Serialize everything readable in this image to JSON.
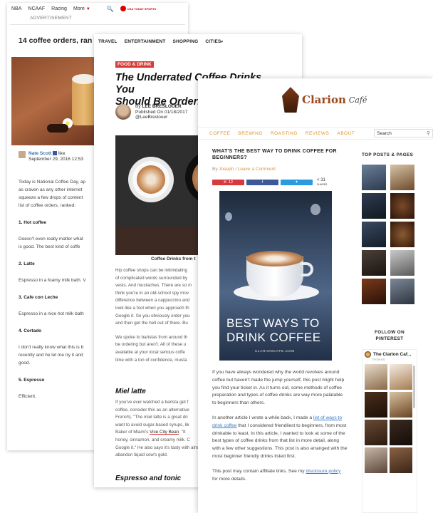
{
  "card1": {
    "nav": {
      "items": [
        "NBA",
        "NCAAF",
        "Racing",
        "More"
      ],
      "logo_text": "USA TODAY SPORTS"
    },
    "ad_label": "ADVERTISEMENT",
    "title": "14 coffee orders, ran",
    "author": {
      "name": "Nate Scott",
      "like": "like",
      "date": "September 29, 2016 12:53"
    },
    "paragraphs": [
      "Today is National Coffee Day, ap",
      "as craven as any other internet",
      "squeeze a few drops of content",
      "list of coffee orders, ranked:"
    ],
    "sections": [
      {
        "heading": "1. Hot coffee",
        "lines": [
          "Doesn't even really matter what",
          "is good. The best kind of coffe"
        ]
      },
      {
        "heading": "2. Latte",
        "lines": [
          "Espresso in a foamy milk bath. V"
        ]
      },
      {
        "heading": "3. Cafe con Leche",
        "lines": [
          "Espresso in a nice hot milk bath"
        ]
      },
      {
        "heading": "4. Cortado",
        "lines": [
          "I don't really know what this is b",
          "recently and he let me try it and",
          "good."
        ]
      },
      {
        "heading": "5. Espresso",
        "lines": [
          "Efficient."
        ]
      }
    ]
  },
  "card2": {
    "nav": [
      "TRAVEL",
      "ENTERTAINMENT",
      "SHOPPING",
      "CITIES"
    ],
    "category": "FOOD & DRINK",
    "title_l1": "The Underrated Coffee Drinks You",
    "title_l2": "Should Be Orderin",
    "author": {
      "by": "By",
      "name": "LEE BRESLOUER",
      "published": "Published On 01/18/2017",
      "handle": "@LeeBreslouer"
    },
    "caption": "Coffee Drinks from t",
    "para1": [
      "Hip coffee shops can be intimidating",
      "of complicated words surrounded by",
      "vests. And mustaches. There are so m",
      "think you're in an old-school spy mov",
      "difference between a cappuccino and",
      "look like a fool when you approach th",
      "Google it. So you obviously order you",
      "and then get the hell out of there. Bu"
    ],
    "para2": [
      "We spoke to baristas from around th",
      "be ordering but aren't. All of these u",
      "available at your local serious coffe",
      "time with a ton of confidence, musta"
    ],
    "h_miel": "Miel latte",
    "para3_pre": [
      "If you've ever watched a barista get f",
      "coffee, consider this as an alternative",
      "French). \"The miel latte is a great dri",
      "want to avoid sugar-based syrups, lik"
    ],
    "para3_line5_pre": "Baker of Miami's ",
    "para3_link": "Vice City Bean",
    "para3_line5_post": ". \"It",
    "para3_post": [
      "honey, cinnamon, and creamy milk. C",
      "Google it.\" He also says it's tasty with almo",
      "abandon liquid cow's gold."
    ],
    "h_espresso": "Espresso and tonic"
  },
  "card3": {
    "logo": {
      "name": "Clarion",
      "sub": "Café"
    },
    "menu": [
      "COFFEE",
      "BREWING",
      "ROASTING",
      "REVIEWS",
      "ABOUT"
    ],
    "search_placeholder": "Search",
    "post_title": "WHAT'S THE BEST WAY TO DRINK COFFEE FOR BEGINNERS?",
    "meta": {
      "by": "By",
      "author": "Joseph",
      "sep": "/",
      "comment": "Leave a Comment"
    },
    "share": {
      "pin_count": "12",
      "total": "31",
      "total_label": "SHARES"
    },
    "hero_caption_l1": "BEST WAYS TO",
    "hero_caption_l2": "DRINK COFFEE",
    "hero_url": "CLARIONCAFE.COM",
    "p1": "If you have always wondered why the world revolves around coffee but haven't made the jump yourself, this post might help you find your ticket in. As it turns out, some methods of coffee preparation and types of coffee drinks are way more palatable to beginners than others.",
    "p2_pre": "In another article I wrote a while back, I made a ",
    "p2_link": "list of ways to drink coffee",
    "p2_post": " that I considered friendliest to beginners, from most drinkable to least. In this article, I wanted to look at some of the best types of coffee drinks from that list in more detail, along with a few other suggestions. This post is also arranged with the most beginner friendly drinks listed first.",
    "p3_pre": "This post may contain affiliate links. See my ",
    "p3_link": "disclosure policy",
    "p3_post": " for more details.",
    "sidebar": {
      "top_posts": "TOP POSTS & PAGES",
      "follow_l1": "FOLLOW ON",
      "follow_l2": "PINTEREST",
      "pin_name": "The Clarion Caf...",
      "pin_sub": "Pinterest"
    },
    "colors": {
      "accent": "#e0922f",
      "link": "#3a7bbf",
      "pinterest": "#d8393d",
      "facebook": "#3c5a99",
      "twitter": "#2b9be0"
    }
  }
}
